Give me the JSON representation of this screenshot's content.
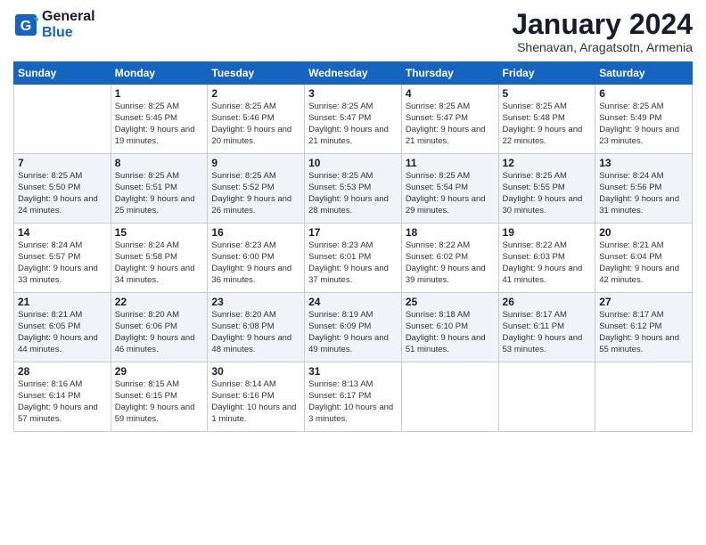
{
  "header": {
    "logo_line1": "General",
    "logo_line2": "Blue",
    "month_title": "January 2024",
    "subtitle": "Shenavan, Aragatsotn, Armenia"
  },
  "days_of_week": [
    "Sunday",
    "Monday",
    "Tuesday",
    "Wednesday",
    "Thursday",
    "Friday",
    "Saturday"
  ],
  "weeks": [
    [
      {
        "num": "",
        "sunrise": "",
        "sunset": "",
        "daylight": ""
      },
      {
        "num": "1",
        "sunrise": "Sunrise: 8:25 AM",
        "sunset": "Sunset: 5:45 PM",
        "daylight": "Daylight: 9 hours and 19 minutes."
      },
      {
        "num": "2",
        "sunrise": "Sunrise: 8:25 AM",
        "sunset": "Sunset: 5:46 PM",
        "daylight": "Daylight: 9 hours and 20 minutes."
      },
      {
        "num": "3",
        "sunrise": "Sunrise: 8:25 AM",
        "sunset": "Sunset: 5:47 PM",
        "daylight": "Daylight: 9 hours and 21 minutes."
      },
      {
        "num": "4",
        "sunrise": "Sunrise: 8:25 AM",
        "sunset": "Sunset: 5:47 PM",
        "daylight": "Daylight: 9 hours and 21 minutes."
      },
      {
        "num": "5",
        "sunrise": "Sunrise: 8:25 AM",
        "sunset": "Sunset: 5:48 PM",
        "daylight": "Daylight: 9 hours and 22 minutes."
      },
      {
        "num": "6",
        "sunrise": "Sunrise: 8:25 AM",
        "sunset": "Sunset: 5:49 PM",
        "daylight": "Daylight: 9 hours and 23 minutes."
      }
    ],
    [
      {
        "num": "7",
        "sunrise": "Sunrise: 8:25 AM",
        "sunset": "Sunset: 5:50 PM",
        "daylight": "Daylight: 9 hours and 24 minutes."
      },
      {
        "num": "8",
        "sunrise": "Sunrise: 8:25 AM",
        "sunset": "Sunset: 5:51 PM",
        "daylight": "Daylight: 9 hours and 25 minutes."
      },
      {
        "num": "9",
        "sunrise": "Sunrise: 8:25 AM",
        "sunset": "Sunset: 5:52 PM",
        "daylight": "Daylight: 9 hours and 26 minutes."
      },
      {
        "num": "10",
        "sunrise": "Sunrise: 8:25 AM",
        "sunset": "Sunset: 5:53 PM",
        "daylight": "Daylight: 9 hours and 28 minutes."
      },
      {
        "num": "11",
        "sunrise": "Sunrise: 8:25 AM",
        "sunset": "Sunset: 5:54 PM",
        "daylight": "Daylight: 9 hours and 29 minutes."
      },
      {
        "num": "12",
        "sunrise": "Sunrise: 8:25 AM",
        "sunset": "Sunset: 5:55 PM",
        "daylight": "Daylight: 9 hours and 30 minutes."
      },
      {
        "num": "13",
        "sunrise": "Sunrise: 8:24 AM",
        "sunset": "Sunset: 5:56 PM",
        "daylight": "Daylight: 9 hours and 31 minutes."
      }
    ],
    [
      {
        "num": "14",
        "sunrise": "Sunrise: 8:24 AM",
        "sunset": "Sunset: 5:57 PM",
        "daylight": "Daylight: 9 hours and 33 minutes."
      },
      {
        "num": "15",
        "sunrise": "Sunrise: 8:24 AM",
        "sunset": "Sunset: 5:58 PM",
        "daylight": "Daylight: 9 hours and 34 minutes."
      },
      {
        "num": "16",
        "sunrise": "Sunrise: 8:23 AM",
        "sunset": "Sunset: 6:00 PM",
        "daylight": "Daylight: 9 hours and 36 minutes."
      },
      {
        "num": "17",
        "sunrise": "Sunrise: 8:23 AM",
        "sunset": "Sunset: 6:01 PM",
        "daylight": "Daylight: 9 hours and 37 minutes."
      },
      {
        "num": "18",
        "sunrise": "Sunrise: 8:22 AM",
        "sunset": "Sunset: 6:02 PM",
        "daylight": "Daylight: 9 hours and 39 minutes."
      },
      {
        "num": "19",
        "sunrise": "Sunrise: 8:22 AM",
        "sunset": "Sunset: 6:03 PM",
        "daylight": "Daylight: 9 hours and 41 minutes."
      },
      {
        "num": "20",
        "sunrise": "Sunrise: 8:21 AM",
        "sunset": "Sunset: 6:04 PM",
        "daylight": "Daylight: 9 hours and 42 minutes."
      }
    ],
    [
      {
        "num": "21",
        "sunrise": "Sunrise: 8:21 AM",
        "sunset": "Sunset: 6:05 PM",
        "daylight": "Daylight: 9 hours and 44 minutes."
      },
      {
        "num": "22",
        "sunrise": "Sunrise: 8:20 AM",
        "sunset": "Sunset: 6:06 PM",
        "daylight": "Daylight: 9 hours and 46 minutes."
      },
      {
        "num": "23",
        "sunrise": "Sunrise: 8:20 AM",
        "sunset": "Sunset: 6:08 PM",
        "daylight": "Daylight: 9 hours and 48 minutes."
      },
      {
        "num": "24",
        "sunrise": "Sunrise: 8:19 AM",
        "sunset": "Sunset: 6:09 PM",
        "daylight": "Daylight: 9 hours and 49 minutes."
      },
      {
        "num": "25",
        "sunrise": "Sunrise: 8:18 AM",
        "sunset": "Sunset: 6:10 PM",
        "daylight": "Daylight: 9 hours and 51 minutes."
      },
      {
        "num": "26",
        "sunrise": "Sunrise: 8:17 AM",
        "sunset": "Sunset: 6:11 PM",
        "daylight": "Daylight: 9 hours and 53 minutes."
      },
      {
        "num": "27",
        "sunrise": "Sunrise: 8:17 AM",
        "sunset": "Sunset: 6:12 PM",
        "daylight": "Daylight: 9 hours and 55 minutes."
      }
    ],
    [
      {
        "num": "28",
        "sunrise": "Sunrise: 8:16 AM",
        "sunset": "Sunset: 6:14 PM",
        "daylight": "Daylight: 9 hours and 57 minutes."
      },
      {
        "num": "29",
        "sunrise": "Sunrise: 8:15 AM",
        "sunset": "Sunset: 6:15 PM",
        "daylight": "Daylight: 9 hours and 59 minutes."
      },
      {
        "num": "30",
        "sunrise": "Sunrise: 8:14 AM",
        "sunset": "Sunset: 6:16 PM",
        "daylight": "Daylight: 10 hours and 1 minute."
      },
      {
        "num": "31",
        "sunrise": "Sunrise: 8:13 AM",
        "sunset": "Sunset: 6:17 PM",
        "daylight": "Daylight: 10 hours and 3 minutes."
      },
      {
        "num": "",
        "sunrise": "",
        "sunset": "",
        "daylight": ""
      },
      {
        "num": "",
        "sunrise": "",
        "sunset": "",
        "daylight": ""
      },
      {
        "num": "",
        "sunrise": "",
        "sunset": "",
        "daylight": ""
      }
    ]
  ]
}
